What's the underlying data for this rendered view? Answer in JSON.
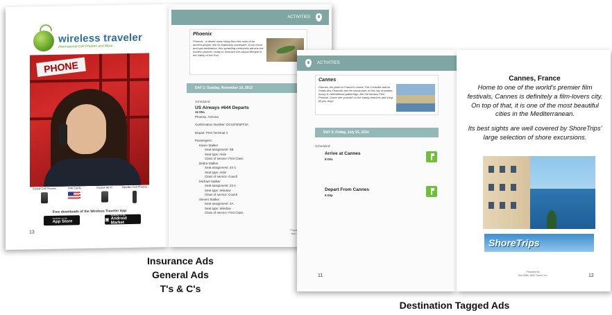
{
  "booklet1": {
    "logo": {
      "name": "wireless traveler",
      "tagline": "International Cell Phones and More..."
    },
    "phone_sign": "PHONE",
    "products": [
      {
        "label": "Global Cell Phones"
      },
      {
        "label": "SIM Cards"
      },
      {
        "label": "Pocket Wi-Fi"
      },
      {
        "label": "Satellite Cell Phones"
      }
    ],
    "downloads_text": "Free downloads of the Wireless Traveler App",
    "stores": [
      {
        "icon": "",
        "small": "Available on the",
        "big": "App Store"
      },
      {
        "icon": "▣",
        "small": "Available on the",
        "big": "Android Market"
      }
    ],
    "left_page_number": "13",
    "activities_label": "ACTIVITIES",
    "destination": {
      "title": "Phoenix",
      "text": "Phoenix - a desert oasis rising from the ruins of an ancient people, like its legendary namesake. A top resort and spa destination, this sprawling metropolis attracts the modern pioneer, ready to embrace the casual lifestyle in the Valley of the Sun."
    },
    "day_label": "DAY 1: Sunday, November 10, 2013",
    "scheduled_label": "Scheduled:",
    "flight": {
      "title": "US Airways #644 Departs",
      "time": "11:00a",
      "place": "Phoenix, Arizona",
      "confirmation": "Confirmation Number: DCUS*ENFF1K",
      "depart": "Depart: PHX Terminal 4",
      "passengers_label": "Passengers:",
      "passengers": [
        {
          "name": "Karen Stalker",
          "seat": "Seat assignment: 4B",
          "type": "Seat type: Aisle",
          "class": "Class of service: First Class"
        },
        {
          "name": "Debra Stalker",
          "seat": "Seat assignment: 23 C",
          "type": "Seat type: Aisle",
          "class": "Class of service: Coach"
        },
        {
          "name": "Michael Stalker",
          "seat": "Seat assignment: 23 A",
          "type": "Seat type: Window",
          "class": "Class of service: Coach"
        },
        {
          "name": "Steven Stalker",
          "seat": "Seat assignment: 4A",
          "type": "Seat type: Window",
          "class": "Class of service: First Class"
        }
      ]
    },
    "prepared": {
      "line1": "Prepared by",
      "line2": "Nan Jones"
    }
  },
  "booklet2": {
    "activities_label": "ACTIVITIES",
    "destination": {
      "title": "Cannes",
      "text": "Cannes, the jewel in France's crown! The Croisette and its Palais des Festivals are the showcases of this city of parties, luxury & international gatherings, like the famous Film Festival. Come see yourself on the sandy beaches and shop till you drop!"
    },
    "day_label": "DAY 3: Friday, July 25, 2014",
    "scheduled_label": "Scheduled:",
    "events": [
      {
        "title": "Arrive at Cannes",
        "time": "8:00a"
      },
      {
        "title": "Depart From Cannes",
        "time": "6:00p"
      }
    ],
    "left_page_number": "11",
    "right_page_number": "12",
    "heading": "Cannes, France",
    "paragraph1": "Home to one of the world's premier film festivals, Cannes is definitely a film-lovers city. On top of that, it is one of the most beautiful cities in the Mediterranean.",
    "paragraph2": "Its best sights are well covered by ShoreTrips' large selection of shore excursions.",
    "shoretrips_logo": "ShoreTrips",
    "prepared": {
      "line1": "Prepared by",
      "line2": "Sue Miller, ABC Travel, Inc."
    }
  },
  "captions": {
    "left": [
      "Insurance Ads",
      "General Ads",
      "T's & C's"
    ],
    "right": "Destination Tagged Ads"
  }
}
